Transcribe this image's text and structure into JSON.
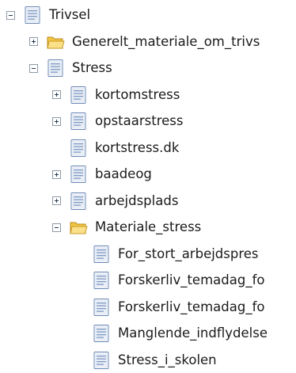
{
  "tree": {
    "nodes": [
      {
        "label": "Trivsel",
        "level": 0,
        "toggle": "minus",
        "icon": "page-icon"
      },
      {
        "label": "Generelt_materiale_om_trivs",
        "level": 1,
        "toggle": "plus",
        "icon": "folder-icon"
      },
      {
        "label": "Stress",
        "level": 1,
        "toggle": "minus",
        "icon": "page-icon"
      },
      {
        "label": "kortomstress",
        "level": 2,
        "toggle": "plus",
        "icon": "page-icon"
      },
      {
        "label": "opstaarstress",
        "level": 2,
        "toggle": "plus",
        "icon": "page-icon"
      },
      {
        "label": "kortstress.dk",
        "level": 2,
        "toggle": "none",
        "icon": "page-icon"
      },
      {
        "label": "baadeog",
        "level": 2,
        "toggle": "plus",
        "icon": "page-icon"
      },
      {
        "label": "arbejdsplads",
        "level": 2,
        "toggle": "plus",
        "icon": "page-icon"
      },
      {
        "label": "Materiale_stress",
        "level": 2,
        "toggle": "minus",
        "icon": "folder-icon"
      },
      {
        "label": "For_stort_arbejdspres",
        "level": 3,
        "toggle": "none",
        "icon": "page-icon"
      },
      {
        "label": "Forskerliv_temadag_fo",
        "level": 3,
        "toggle": "none",
        "icon": "page-icon"
      },
      {
        "label": "Forskerliv_temadag_fo",
        "level": 3,
        "toggle": "none",
        "icon": "page-icon"
      },
      {
        "label": "Manglende_indflydelse",
        "level": 3,
        "toggle": "none",
        "icon": "page-icon"
      },
      {
        "label": "Stress_i_skolen",
        "level": 3,
        "toggle": "none",
        "icon": "page-icon"
      }
    ]
  }
}
